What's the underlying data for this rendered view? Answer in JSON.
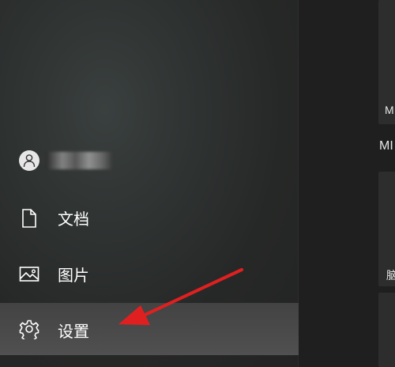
{
  "start_menu": {
    "account": {
      "icon": "user-icon",
      "name_obscured": true
    },
    "items": [
      {
        "label": "文档",
        "icon": "document-icon"
      },
      {
        "label": "图片",
        "icon": "pictures-icon"
      },
      {
        "label": "设置",
        "icon": "gear-icon",
        "highlighted": true
      }
    ]
  },
  "tiles": {
    "top_tile_label": "M",
    "group_header": "MI",
    "mid_tile_label": "脑"
  },
  "annotation": {
    "arrow_color": "#e02020",
    "points_to": "设置"
  }
}
